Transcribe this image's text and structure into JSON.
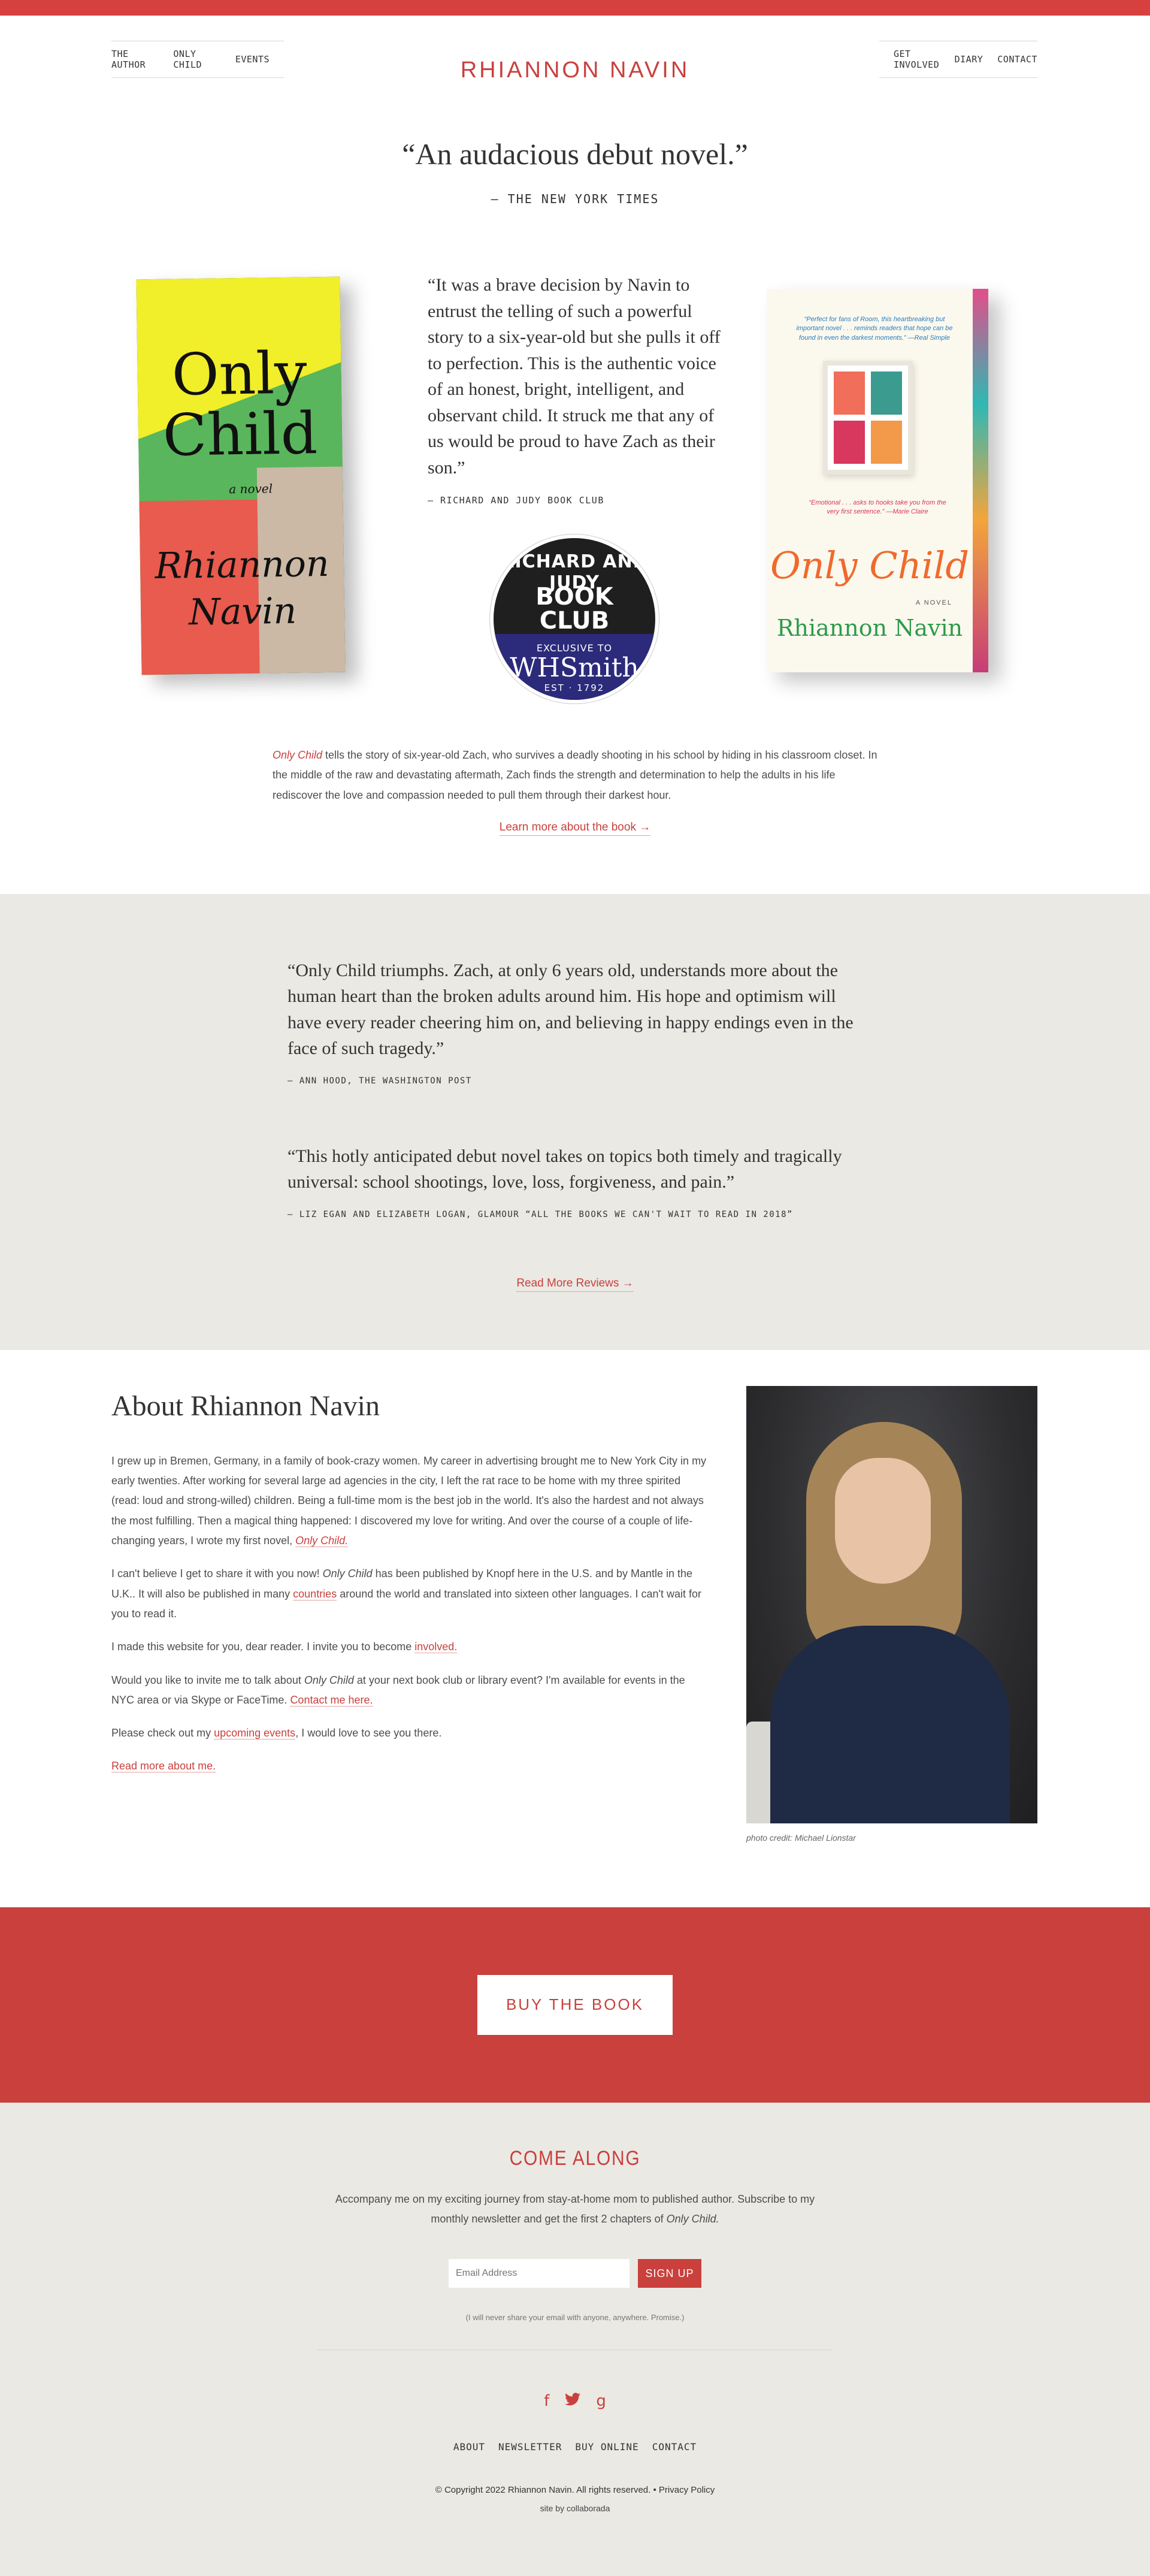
{
  "colors": {
    "brand": "#c9403d",
    "topbar": "#d6413f",
    "band_bg": "#ebe9e4"
  },
  "nav": {
    "left": [
      "The Author",
      "Only Child",
      "Events"
    ],
    "right": [
      "Get Involved",
      "Diary",
      "Contact"
    ]
  },
  "site_title": "RHIANNON NAVIN",
  "hero": {
    "quote": "“An audacious debut novel.”",
    "source": "– THE NEW YORK TIMES"
  },
  "book_left": {
    "title_1": "Only",
    "title_2": "Child",
    "subtitle": "a novel",
    "author_1": "Rhiannon",
    "author_2": "Navin"
  },
  "book_right": {
    "blurb_top": "“Perfect for fans of Room, this heartbreaking but important novel . . . reminds readers that hope can be found in even the darkest moments.” —Real Simple",
    "blurb_mid": "“Emotional . . . asks to hooks take you from the very first sentence.” —Marie Claire",
    "title": "Only Child",
    "label": "A NOVEL",
    "author": "Rhiannon Navin"
  },
  "pull_quote": {
    "text": "“It was a brave decision by Navin to entrust the telling of such a powerful story to a six-year-old but she pulls it off to perfection. This is the authentic voice of an honest, bright, intelligent, and observant child. It struck me that any of us would be proud to have Zach as their son.”",
    "source": "– RICHARD AND JUDY BOOK CLUB"
  },
  "badge": {
    "top": "RICHARD AND JUDY",
    "book": "BOOK",
    "club": "CLUB",
    "exclusive": "EXCLUSIVE TO",
    "store": "WHSmith",
    "est": "EST · 1792"
  },
  "description": {
    "book_title": "Only Child",
    "text": " tells the story of six-year-old Zach, who survives a deadly shooting in his school by hiding in his classroom closet. In the middle of the raw and devastating aftermath, Zach finds the strength and determination to help the adults in his life rediscover the love and compassion needed to pull them through their darkest hour.",
    "learn_more": "Learn more about the book →"
  },
  "reviews": [
    {
      "text": "“Only Child triumphs. Zach, at only 6 years old, understands more about the human heart than the broken adults around him. His hope and optimism will have every reader cheering him on, and believing in happy endings even in the face of such tragedy.”",
      "source": "— ANN HOOD, THE WASHINGTON POST"
    },
    {
      "text": "“This hotly anticipated debut novel takes on topics both timely and tragically universal: school shootings, love, loss, forgiveness, and pain.”",
      "source": "— LIZ EGAN AND ELIZABETH LOGAN, GLAMOUR “ALL THE BOOKS WE CAN'T WAIT TO READ IN 2018”"
    }
  ],
  "read_more_reviews": "Read More Reviews →",
  "about": {
    "heading": "About Rhiannon Navin",
    "p1": "I grew up in Bremen, Germany, in a family of book-crazy women. My career in advertising brought me to New York City in my early twenties. After working for several large ad agencies in the city, I left the rat race to be home with my three spirited (read: loud and strong-willed) children. Being a full-time mom is the best job in the world. It's also the hardest and not always the most fulfilling. Then a magical thing happened: I discovered my love for writing. And over the course of a couple of life-changing years, I wrote my first novel, ",
    "p1_link": "Only Child.",
    "p2a": "I can't believe I get to share it with you now! ",
    "p2_title": "Only Child",
    "p2b": " has been published by Knopf here in the U.S. and by Mantle in the U.K.. It will also be published in many ",
    "p2_link": "countries",
    "p2c": " around the world and translated into sixteen other languages. I can't wait for you to read it.",
    "p3a": "I made this website for you, dear reader. I invite you to become ",
    "p3_link": "involved.",
    "p4a": "Would you like to invite me to talk about ",
    "p4_title": "Only Child",
    "p4b": " at your next book club or library event? I'm available for events in the NYC area or via Skype or FaceTime. ",
    "p4_link": "Contact me here.",
    "p5a": "Please check out my ",
    "p5_link": "upcoming events",
    "p5b": ", I would love to see you there.",
    "read_more": "Read more about me.",
    "photo_credit": "photo credit: Michael Lionstar"
  },
  "buy_button": "BUY THE BOOK",
  "newsletter": {
    "heading": "COME ALONG",
    "intro_a": "Accompany me on my exciting journey from stay-at-home mom to published author. Subscribe to my monthly newsletter and get the first 2 chapters of ",
    "intro_title": "Only Child.",
    "email_placeholder": "Email Address",
    "signup": "SIGN UP",
    "note": "(I will never share your email with anyone, anywhere. Promise.)"
  },
  "social": {
    "facebook": "f",
    "twitter": "twitter-icon",
    "goodreads": "g"
  },
  "footer": {
    "nav": [
      "ABOUT",
      "NEWSLETTER",
      "BUY ONLINE",
      "CONTACT"
    ],
    "copyright": "© Copyright 2022 Rhiannon Navin. All rights reserved. • Privacy Policy",
    "site_by": "site by collaborada"
  }
}
